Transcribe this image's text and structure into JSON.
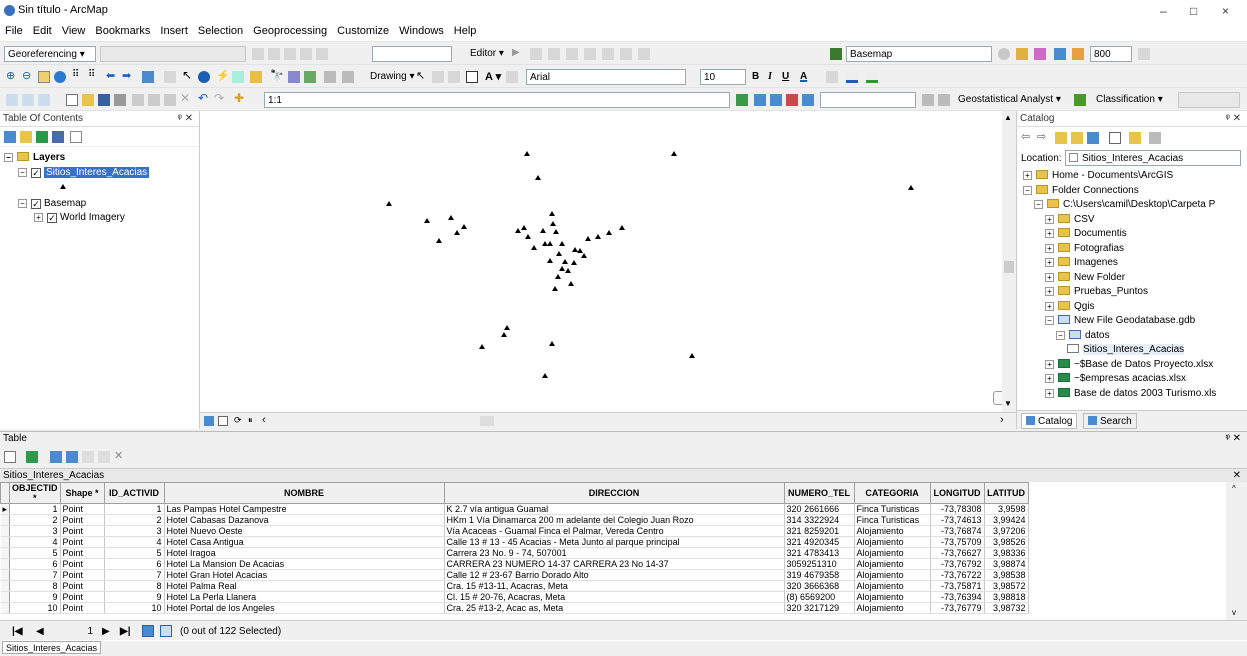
{
  "window": {
    "title": "Sin título - ArcMap",
    "min": "–",
    "max": "□",
    "close": "×"
  },
  "menu": [
    "File",
    "Edit",
    "View",
    "Bookmarks",
    "Insert",
    "Selection",
    "Geoprocessing",
    "Customize",
    "Windows",
    "Help"
  ],
  "toolbar1": {
    "georef": "Georeferencing ▾",
    "editor": "Editor ▾",
    "basemap": "Basemap",
    "scale_val": "800"
  },
  "toolbar2": {
    "drawing": "Drawing ▾",
    "font": "Arial",
    "size": "10",
    "bold": "B",
    "italic": "I",
    "underline": "U",
    "text_a": "A"
  },
  "toolbar3": {
    "scale": "1:1",
    "geostat": "Geostatistical Analyst ▾",
    "classification": "Classification ▾"
  },
  "toc": {
    "title": "Table Of Contents",
    "layers": "Layers",
    "layer1": "Sitios_Interes_Acacias",
    "basemap": "Basemap",
    "imagery": "World Imagery"
  },
  "catalog": {
    "title": "Catalog",
    "location_label": "Location:",
    "location_value": "Sitios_Interes_Acacias",
    "items": [
      {
        "label": "Home - Documents\\ArcGIS",
        "indent": 0
      },
      {
        "label": "Folder Connections",
        "indent": 0
      },
      {
        "label": "C:\\Users\\camil\\Desktop\\Carpeta P",
        "indent": 1
      },
      {
        "label": "CSV",
        "indent": 2
      },
      {
        "label": "Documentis",
        "indent": 2
      },
      {
        "label": "Fotografias",
        "indent": 2
      },
      {
        "label": "Imagenes",
        "indent": 2
      },
      {
        "label": "New Folder",
        "indent": 2
      },
      {
        "label": "Pruebas_Puntos",
        "indent": 2
      },
      {
        "label": "Qgis",
        "indent": 2
      },
      {
        "label": "New File Geodatabase.gdb",
        "indent": 2
      },
      {
        "label": "datos",
        "indent": 3
      },
      {
        "label": "Sitios_Interes_Acacias",
        "indent": 4
      },
      {
        "label": "~$Base de Datos Proyecto.xlsx",
        "indent": 2
      },
      {
        "label": "~$empresas acacias.xlsx",
        "indent": 2
      },
      {
        "label": "Base de datos 2003 Turismo.xls",
        "indent": 2
      }
    ],
    "tab_catalog": "Catalog",
    "tab_search": "Search"
  },
  "table": {
    "title": "Table",
    "layer": "Sitios_Interes_Acacias",
    "columns": [
      "OBJECTID *",
      "Shape *",
      "ID_ACTIVID",
      "NOMBRE",
      "DIRECCION",
      "NUMERO_TEL",
      "CATEGORIA",
      "LONGITUD",
      "LATITUD"
    ],
    "rows": [
      [
        "1",
        "Point",
        "1",
        "Las Pampas Hotel Campestre",
        "K 2.7 vía antigua Guamal",
        "320 2661666",
        "Finca Turisticas",
        "-73,78308",
        "3,9598"
      ],
      [
        "2",
        "Point",
        "2",
        "Hotel Cabasas Dazanova",
        "HKm 1 Vía Dinamarca 200 m adelante del Colegio Juan Rozo",
        "314 3322924",
        "Finca Turisticas",
        "-73,74613",
        "3,99424"
      ],
      [
        "3",
        "Point",
        "3",
        "Hotel Nuevo Oeste",
        "Vía Acaceas - Guamal Finca el Palmar, Vereda Centro",
        "321 8259201",
        "Alojamiento",
        "-73,76874",
        "3,97206"
      ],
      [
        "4",
        "Point",
        "4",
        "Hotel Casa Antigua",
        "Calle 13 # 13 - 45 Acacias - Meta Junto al parque principal",
        "321 4920345",
        "Alojamiento",
        "-73,75709",
        "3,98526"
      ],
      [
        "5",
        "Point",
        "5",
        "Hotel Iragoa",
        "Carrera 23 No. 9 - 74, 507001",
        "321 4783413",
        "Alojamiento",
        "-73,76627",
        "3,98336"
      ],
      [
        "6",
        "Point",
        "6",
        "Hotel La Mansion De Acacias",
        "CARRERA 23 NUMERO 14-37 CARRERA 23 No 14-37",
        "3059251310",
        "Alojamiento",
        "-73,76792",
        "3,98874"
      ],
      [
        "7",
        "Point",
        "7",
        "Hotel Gran Hotel Acacias",
        "Calle 12 # 23-67  Barrio Dorado Alto",
        "319 4679358",
        "Alojamiento",
        "-73,76722",
        "3,98538"
      ],
      [
        "8",
        "Point",
        "8",
        "Hotel Palma Real",
        "Cra. 15 #13-11, Acacras, Meta",
        "320 3666368",
        "Alojamiento",
        "-73,75871",
        "3,98572"
      ],
      [
        "9",
        "Point",
        "9",
        "Hotel La Perla Llanera",
        "Cl. 15 # 20-76, Acacras, Meta",
        "(8) 6569200",
        "Alojamiento",
        "-73,76394",
        "3,98818"
      ],
      [
        "10",
        "Point",
        "10",
        "Hotel Portal de los Angeles",
        "Cra. 25 #13-2, Acac as, Meta",
        "320 3217129",
        "Alojamiento",
        "-73,76779",
        "3,98732"
      ]
    ],
    "record": "1",
    "selected_text": "(0 out of 122 Selected)"
  },
  "status": {
    "layer_tab": "Sitios_Interes_Acacias"
  }
}
